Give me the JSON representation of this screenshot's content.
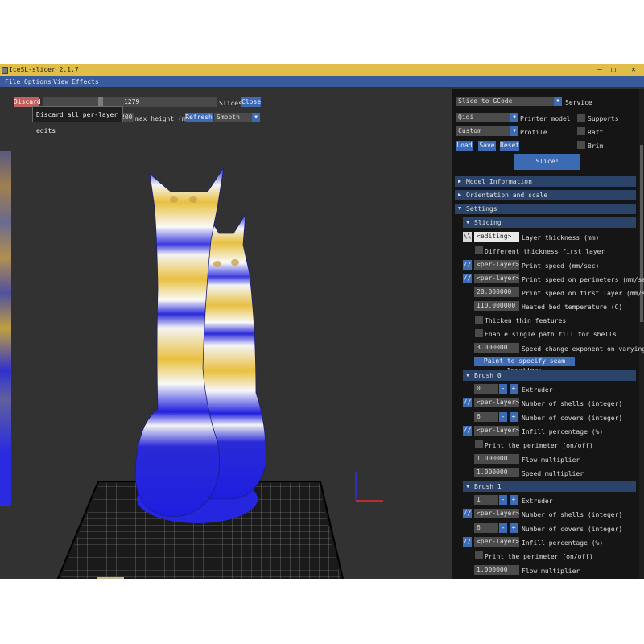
{
  "window": {
    "title": "IceSL-slicer 2.1.7",
    "controls": [
      "—",
      "▢",
      "✕"
    ]
  },
  "menu": [
    "File",
    "Options",
    "View",
    "Effects"
  ],
  "toolbar": {
    "discard_label": "Discard",
    "tooltip": "Discard all per-layer edits",
    "slider_value": "1279",
    "slices_label": "Slices",
    "close_label": "Close",
    "height_value": "200",
    "max_height_label": "max height (mm)",
    "refresh_label": "Refresh",
    "smooth_value": "Smooth"
  },
  "panel": {
    "service": {
      "value": "Slice to GCode",
      "label": "Service"
    },
    "printer": {
      "value": "Qidi",
      "label": "Printer model"
    },
    "profile": {
      "value": "Custom",
      "label": "Profile"
    },
    "checks": [
      "Supports",
      "Raft",
      "Brim"
    ],
    "buttons": {
      "load": "Load",
      "save": "Save",
      "reset": "Reset"
    },
    "slice_label": "Slice!",
    "sections": {
      "model_info": "Model Information",
      "orientation": "Orientation and scale",
      "settings": "Settings",
      "slicing": "Slicing",
      "brush0": "Brush 0",
      "brush1": "Brush 1"
    },
    "slicing_rows": {
      "layer_mode": "\\\\",
      "layer_value": "<editing>",
      "layer_label": "Layer thickness (mm)",
      "diff_first": "Different thickness first layer",
      "speed_mode": "//",
      "speed_value": "<per-layer>",
      "speed_label": "Print speed (mm/sec)",
      "perim_mode": "//",
      "perim_value": "<per-layer>",
      "perim_label": "Print speed on perimeters (mm/sec)",
      "first_value": "20.000000",
      "first_label": "Print speed on first layer (mm/sec)",
      "bed_value": "110.000000",
      "bed_label": "Heated bed temperature (C)",
      "thicken": "Thicken thin features",
      "single_path": "Enable single path fill for shells",
      "exponent_value": "3.000000",
      "exponent_label": "Speed change exponent on varying widt",
      "seam_label": "Paint to specify seam locations"
    },
    "brush0": {
      "extruder_value": "0",
      "extruder_label": "Extruder",
      "shells_mode": "//",
      "shells_value": "<per-layer>",
      "shells_label": "Number of shells (integer)",
      "covers_value": "6",
      "covers_label": "Number of covers (integer)",
      "infill_mode": "//",
      "infill_value": "<per-layer>",
      "infill_label": "Infill percentage (%)",
      "print_perimeter": "Print the perimeter (on/off)",
      "flow_value": "1.000000",
      "flow_label": "Flow multiplier",
      "speed_value": "1.000000",
      "speed_label": "Speed multiplier"
    },
    "brush1": {
      "extruder_value": "1",
      "extruder_label": "Extruder",
      "shells_mode": "//",
      "shells_value": "<per-layer>",
      "shells_label": "Number of shells (integer)",
      "covers_value": "6",
      "covers_label": "Number of covers (integer)",
      "infill_mode": "//",
      "infill_value": "<per-layer>",
      "infill_label": "Infill percentage (%)",
      "print_perimeter": "Print the perimeter (on/off)",
      "flow_value": "1.000000",
      "flow_label": "Flow multiplier"
    },
    "pm": {
      "minus": "-",
      "plus": "+"
    }
  },
  "colors": {
    "title_bar": "#e0be47",
    "menu_bar": "#3a5b9b",
    "button": "#3d6bb3",
    "section": "#2b4368",
    "model_blue": "#2020e0",
    "model_yellow": "#e8c040"
  }
}
